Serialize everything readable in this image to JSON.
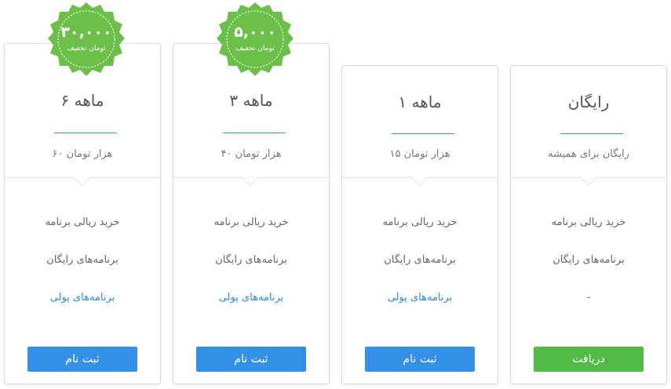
{
  "plans": [
    {
      "title": "۶ ماهه",
      "price": "۶۰ هزار تومان",
      "features": [
        "خرید ریالی برنامه",
        "برنامه‌های رایگان",
        "برنامه‌های پولی"
      ],
      "button": "ثبت نام"
    },
    {
      "title": "۳ ماهه",
      "price": "۴۰ هزار تومان",
      "features": [
        "خرید ریالی برنامه",
        "برنامه‌های رایگان",
        "برنامه‌های پولی"
      ],
      "button": "ثبت نام"
    },
    {
      "title": "۱ ماهه",
      "price": "۱۵ هزار تومان",
      "features": [
        "خرید ریالی برنامه",
        "برنامه‌های رایگان",
        "برنامه‌های پولی"
      ],
      "button": "ثبت نام"
    },
    {
      "title": "رایگان",
      "price": "رایگان برای همیشه",
      "features": [
        "خرید ریالی برنامه",
        "برنامه‌های رایگان",
        "-"
      ],
      "button": "دریافت"
    }
  ],
  "badges": [
    {
      "amount": "۳۰,۰۰۰",
      "label": "تومان تخفیف"
    },
    {
      "amount": "۵,۰۰۰",
      "label": "تومان تخفیف"
    }
  ],
  "colors": {
    "accent_blue": "#3390e6",
    "accent_green": "#52bb48",
    "badge_green": "#6cc04a",
    "link_blue": "#2c8ad8"
  }
}
